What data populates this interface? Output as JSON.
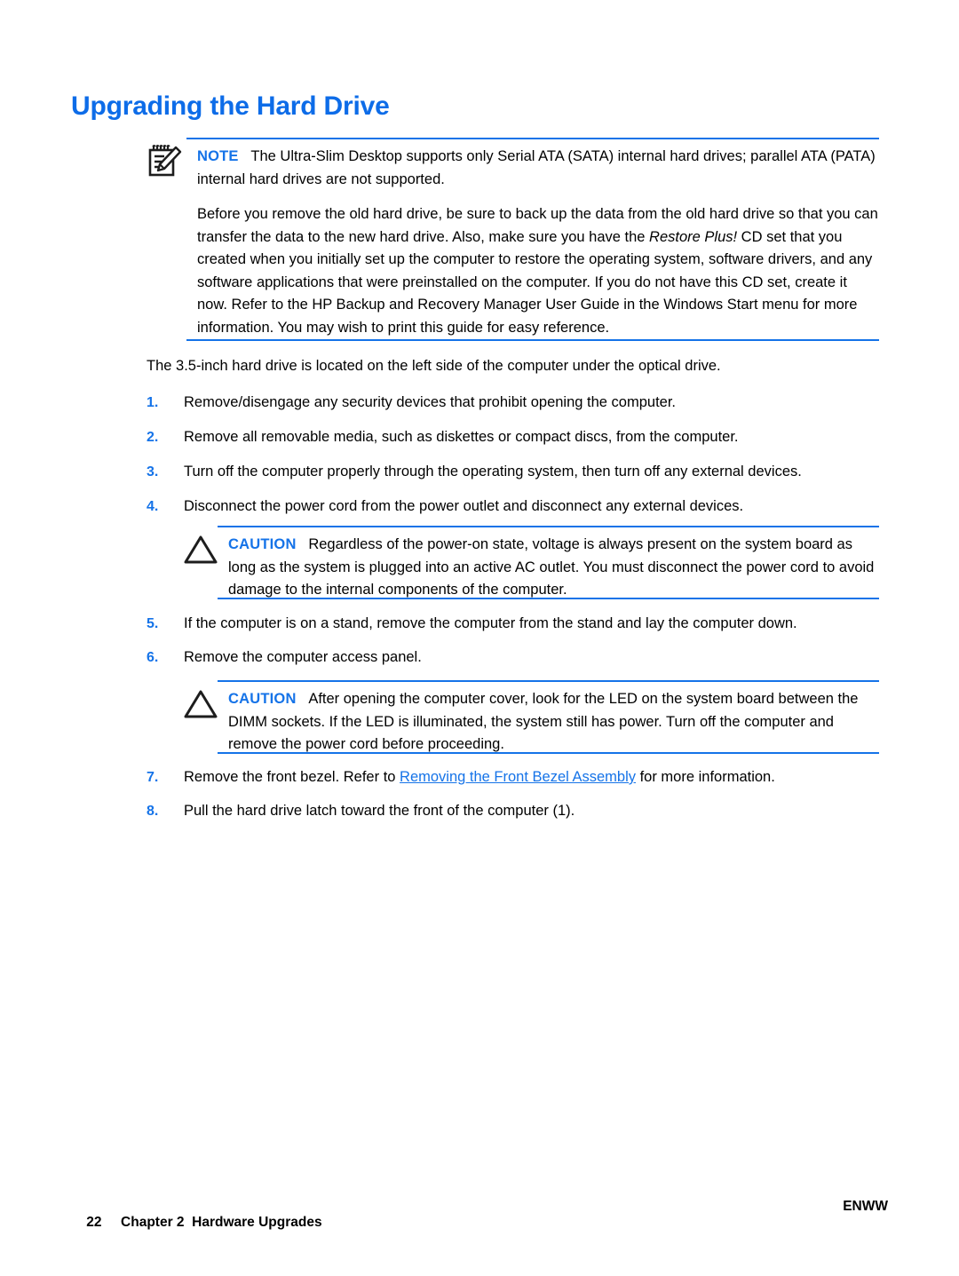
{
  "document": {
    "title": "Upgrading the Hard Drive",
    "accent_color": "#1573e8",
    "text_color": "#000000"
  },
  "note": {
    "icon": "notepad-pencil-icon",
    "label": "NOTE",
    "text": "The Ultra-Slim Desktop supports only Serial ATA (SATA) internal hard drives; parallel ATA (PATA) internal hard drives are not supported.",
    "paragraph_part1": "Before you remove the old hard drive, be sure to back up the data from the old hard drive so that you can transfer the data to the new hard drive. Also, make sure you have the ",
    "paragraph_italic": "Restore Plus!",
    "paragraph_part2": " CD set that you created when you initially set up the computer to restore the operating system, software drivers, and any software applications that were preinstalled on the computer. If you do not have this CD set, create it now. Refer to the HP Backup and Recovery Manager User Guide in the Windows Start menu for more information. You may wish to print this guide for easy reference."
  },
  "intro_paragraph": "The 3.5-inch hard drive is located on the left side of the computer under the optical drive.",
  "steps": [
    {
      "number": "1.",
      "text": "Remove/disengage any security devices that prohibit opening the computer."
    },
    {
      "number": "2.",
      "text": "Remove all removable media, such as diskettes or compact discs, from the computer."
    },
    {
      "number": "3.",
      "text": "Turn off the computer properly through the operating system, then turn off any external devices."
    },
    {
      "number": "4.",
      "text": "Disconnect the power cord from the power outlet and disconnect any external devices."
    },
    {
      "number": "5.",
      "text": "If the computer is on a stand, remove the computer from the stand and lay the computer down."
    },
    {
      "number": "6.",
      "text": "Remove the computer access panel."
    },
    {
      "number": "7.",
      "text_before_link": "Remove the front bezel. Refer to ",
      "link_text": "Removing the Front Bezel Assembly",
      "text_after_link": " for more information."
    },
    {
      "number": "8.",
      "text": "Pull the hard drive latch toward the front of the computer (1)."
    }
  ],
  "caution_1": {
    "icon": "warning-triangle-icon",
    "label": "CAUTION",
    "text": "Regardless of the power-on state, voltage is always present on the system board as long as the system is plugged into an active AC outlet. You must disconnect the power cord to avoid damage to the internal components of the computer."
  },
  "caution_2": {
    "icon": "warning-triangle-icon",
    "label": "CAUTION",
    "text": "After opening the computer cover, look for the LED on the system board between the DIMM sockets. If the LED is illuminated, the system still has power. Turn off the computer and remove the power cord before proceeding."
  },
  "footer": {
    "page_number": "22",
    "chapter": "Chapter 2",
    "chapter_title": "Hardware Upgrades",
    "locale": "ENWW"
  }
}
